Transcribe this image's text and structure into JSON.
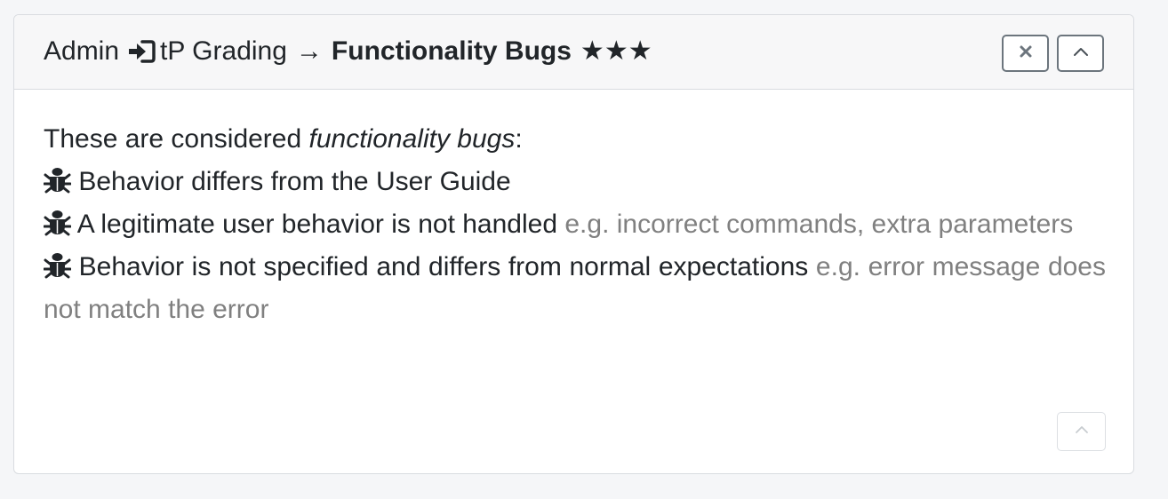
{
  "header": {
    "breadcrumb_root": "Admin",
    "breadcrumb_middle": "tP Grading",
    "arrow": "→",
    "title": "Functionality Bugs",
    "stars": "★★★",
    "icons": {
      "separator": "sign-in-icon",
      "close": "close-icon",
      "collapse": "chevron-up-icon"
    }
  },
  "body": {
    "intro_prefix": "These are considered ",
    "intro_emphasis": "functionality bugs",
    "intro_suffix": ":",
    "items": [
      {
        "text": "Behavior differs from the User Guide",
        "example": ""
      },
      {
        "text": "A legitimate user behavior is not handled",
        "example": "e.g. incorrect commands, extra parameters"
      },
      {
        "text": "Behavior is not specified and differs from normal expectations",
        "example": "e.g. error message does not match the error"
      }
    ],
    "item_icon": "bug-icon"
  },
  "footer": {
    "collapse_icon": "chevron-up-icon"
  },
  "colors": {
    "muted_text": "#808080",
    "header_bg": "#f7f7f8",
    "border": "#d9dce0"
  }
}
